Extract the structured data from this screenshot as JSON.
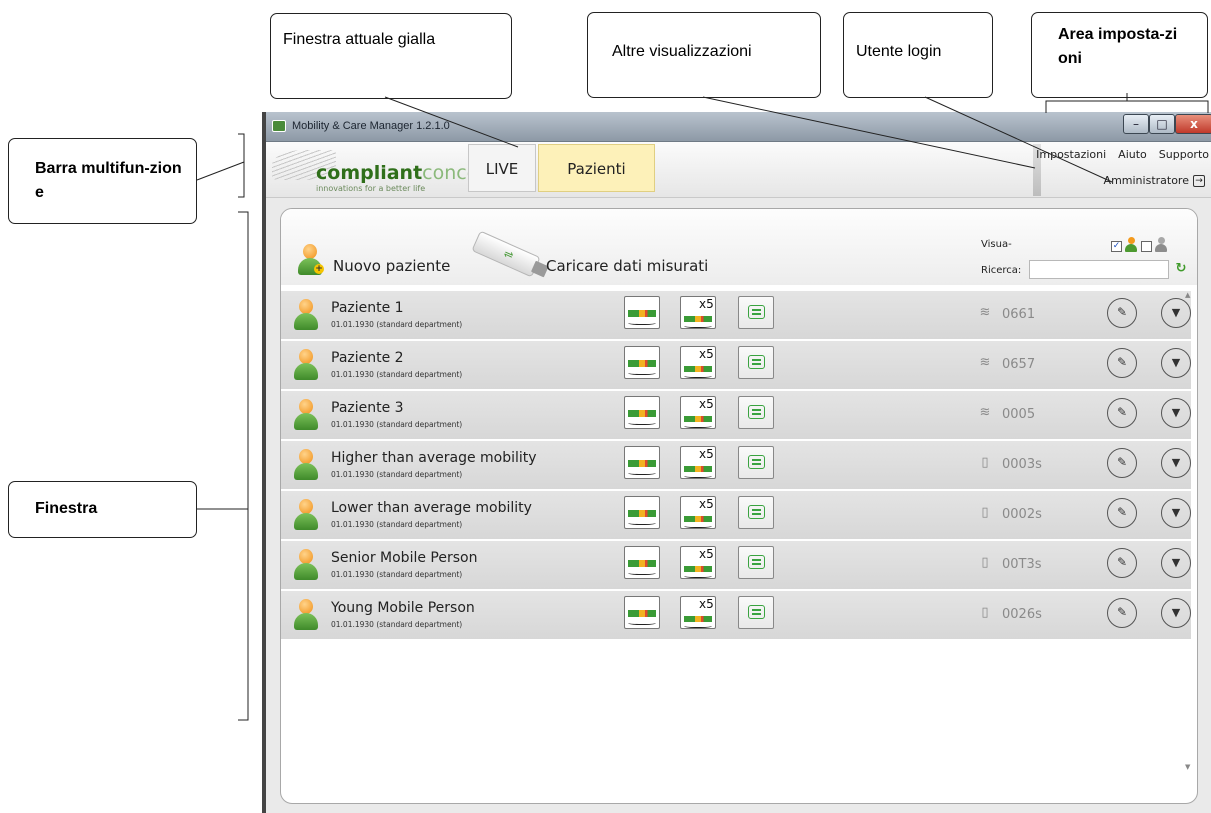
{
  "callouts": {
    "finestra_attuale": "Finestra attuale gialla",
    "altre_visualizzazioni": "Altre visualizzazioni",
    "utente_login": "Utente login",
    "area_impostazioni": "Area imposta-zioni",
    "barra_multifunzione": "Barra multifun-zione",
    "finestra": "Finestra"
  },
  "window": {
    "title": "Mobility & Care Manager 1.2.1.0",
    "min": "–",
    "max": "□",
    "close": "x"
  },
  "ribbon": {
    "brand_bold": "compliant",
    "brand_light": "concept",
    "tagline": "innovations for a better life",
    "tabs": [
      {
        "label": "LIVE",
        "active": false
      },
      {
        "label": "Pazienti",
        "active": true,
        "color": "#fdf1b9"
      }
    ],
    "links": {
      "settings": "Impostazioni",
      "help": "Aiuto",
      "support": "Supporto"
    },
    "user": "Amministratore"
  },
  "panel": {
    "new_patient": "Nuovo paziente",
    "load_data": "Caricare dati misurati",
    "view_label": "Visua-",
    "search_label": "Ricerca:",
    "search_value": "",
    "checkbox_active_checked": true,
    "checkbox_inactive_checked": false
  },
  "patients": [
    {
      "name": "Paziente 1",
      "meta": "01.01.1930  (standard department)",
      "device_icon": "wifi-icon",
      "device": "0661"
    },
    {
      "name": "Paziente 2",
      "meta": "01.01.1930  (standard department)",
      "device_icon": "wifi-icon",
      "device": "0657"
    },
    {
      "name": "Paziente 3",
      "meta": "01.01.1930  (standard department)",
      "device_icon": "wifi-icon",
      "device": "0005"
    },
    {
      "name": "Higher than average mobility",
      "meta": "01.01.1930  (standard department)",
      "device_icon": "usb-stick-icon",
      "device": "0003s"
    },
    {
      "name": "Lower than average mobility",
      "meta": "01.01.1930  (standard department)",
      "device_icon": "usb-stick-icon",
      "device": "0002s"
    },
    {
      "name": "Senior Mobile Person",
      "meta": "01.01.1930  (standard department)",
      "device_icon": "usb-stick-icon",
      "device": "00T3s"
    },
    {
      "name": "Young Mobile Person",
      "meta": "01.01.1930  (standard department)",
      "device_icon": "usb-stick-icon",
      "device": "0026s"
    }
  ],
  "row_buttons": {
    "multi_label": "x5"
  },
  "colors": {
    "active_tab": "#fdf1b9",
    "brand_green": "#2f6f1a",
    "message_green": "#3aa340",
    "row_bg": "#dedede"
  }
}
